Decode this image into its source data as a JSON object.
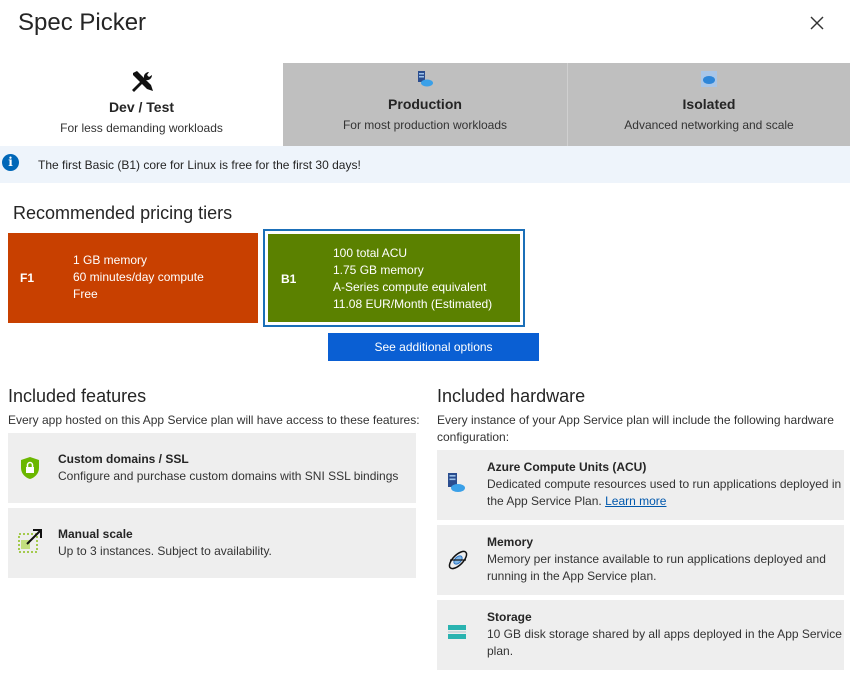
{
  "header": {
    "title": "Spec Picker"
  },
  "tabs": [
    {
      "name": "Dev / Test",
      "desc": "For less demanding workloads"
    },
    {
      "name": "Production",
      "desc": "For most production workloads"
    },
    {
      "name": "Isolated",
      "desc": "Advanced networking and scale"
    }
  ],
  "banner": {
    "text": "The first Basic (B1) core for Linux is free for the first 30 days!"
  },
  "recommended": {
    "heading": "Recommended pricing tiers",
    "tiers": [
      {
        "code": "F1",
        "lines": [
          "1 GB memory",
          "60 minutes/day compute",
          "Free"
        ],
        "color": "#c84000",
        "selected": false
      },
      {
        "code": "B1",
        "lines": [
          "100 total ACU",
          "1.75 GB memory",
          "A-Series compute equivalent",
          "11.08 EUR/Month (Estimated)"
        ],
        "color": "#5b8100",
        "selected": true
      }
    ],
    "more_button": "See additional options"
  },
  "features": {
    "heading": "Included features",
    "desc": "Every app hosted on this App Service plan will have access to these features:",
    "items": [
      {
        "title": "Custom domains / SSL",
        "text": "Configure and purchase custom domains with SNI SSL bindings",
        "icon": "shield-lock-icon"
      },
      {
        "title": "Manual scale",
        "text": "Up to 3 instances. Subject to availability.",
        "icon": "scale-icon"
      }
    ]
  },
  "hardware": {
    "heading": "Included hardware",
    "desc_lines": [
      "Every instance of your App Service plan will include the following hardware",
      "configuration:"
    ],
    "items": [
      {
        "title": "Azure Compute Units (ACU)",
        "text_lines": [
          "Dedicated compute resources used to run applications deployed in",
          "the App Service Plan."
        ],
        "link": "Learn more",
        "icon": "compute-icon"
      },
      {
        "title": "Memory",
        "text_lines": [
          "Memory per instance available to run applications deployed and",
          "running in the App Service plan."
        ],
        "icon": "memory-icon"
      },
      {
        "title": "Storage",
        "text_lines": [
          "10 GB disk storage shared by all apps deployed in the App Service",
          "plan."
        ],
        "icon": "storage-icon"
      }
    ]
  },
  "colors": {
    "accent": "#0a5fd3",
    "selected_border": "#1b6fb8",
    "inactive_tab": "#bfbfbf"
  }
}
